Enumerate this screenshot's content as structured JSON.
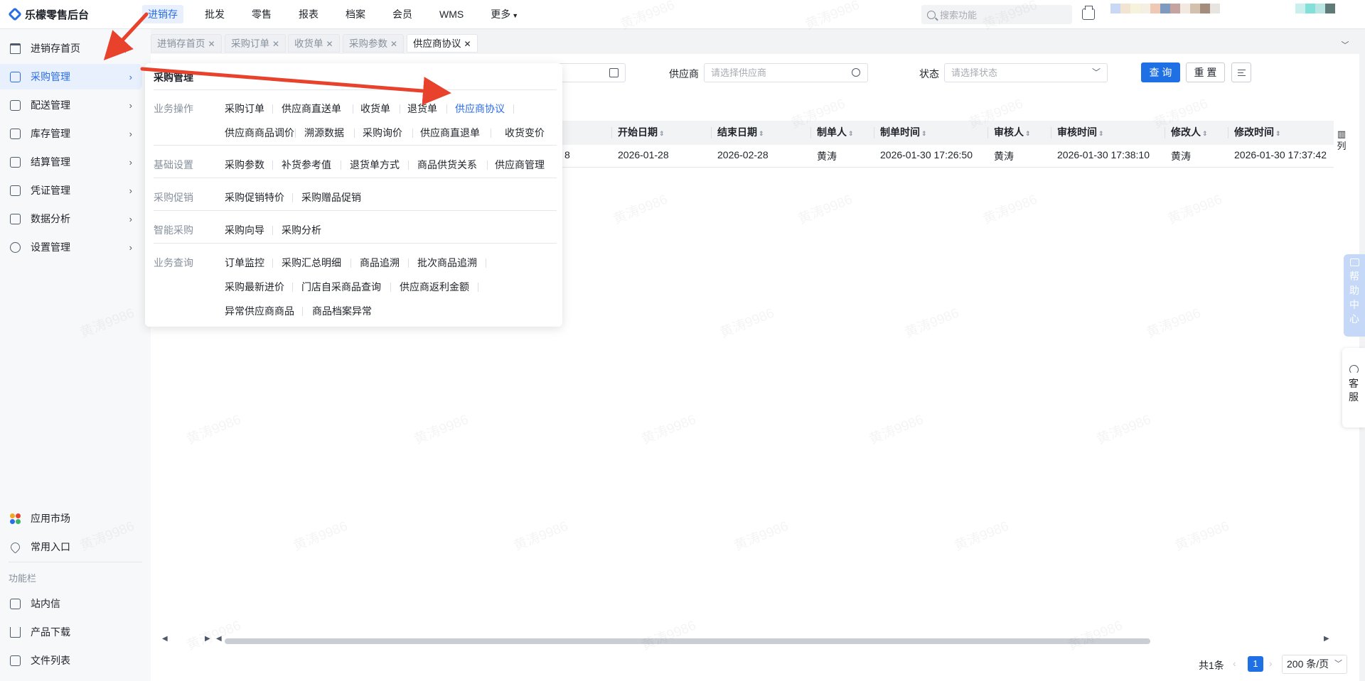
{
  "app": {
    "title": "乐檬零售后台"
  },
  "topnav": {
    "items": [
      "进销存",
      "批发",
      "零售",
      "报表",
      "档案",
      "会员",
      "WMS",
      "更多"
    ],
    "search_placeholder": "搜索功能"
  },
  "sidebar": {
    "items": [
      {
        "label": "进销存首页",
        "icon": "home-icon"
      },
      {
        "label": "采购管理",
        "icon": "cart-icon"
      },
      {
        "label": "配送管理",
        "icon": "delivery-icon"
      },
      {
        "label": "库存管理",
        "icon": "inventory-icon"
      },
      {
        "label": "结算管理",
        "icon": "settlement-icon"
      },
      {
        "label": "凭证管理",
        "icon": "voucher-icon"
      },
      {
        "label": "数据分析",
        "icon": "chart-icon"
      },
      {
        "label": "设置管理",
        "icon": "settings-icon"
      }
    ],
    "bottom": {
      "app_market": "应用市场",
      "favorites": "常用入口",
      "section_caption": "功能栏",
      "messages": "站内信",
      "downloads": "产品下载",
      "files": "文件列表"
    }
  },
  "tabs": [
    {
      "label": "进销存首页"
    },
    {
      "label": "采购订单"
    },
    {
      "label": "收货单"
    },
    {
      "label": "采购参数"
    },
    {
      "label": "供应商协议"
    }
  ],
  "filters": {
    "supplier_label": "供应商",
    "supplier_placeholder": "请选择供应商",
    "status_label": "状态",
    "status_placeholder": "请选择状态",
    "query_label": "查 询",
    "reset_label": "重 置"
  },
  "table": {
    "columns": [
      "开始日期",
      "结束日期",
      "制单人",
      "制单时间",
      "审核人",
      "审核时间",
      "修改人",
      "修改时间"
    ],
    "rows": [
      {
        "partial": "8",
        "start_date": "2026-01-28",
        "end_date": "2026-02-28",
        "creator": "黄涛",
        "created_at": "2026-01-30 17:26:50",
        "auditor": "黄涛",
        "audited_at": "2026-01-30 17:38:10",
        "modifier": "黄涛",
        "modified_at": "2026-01-30 17:37:42"
      }
    ],
    "column_settings": "列"
  },
  "pagination": {
    "total": "共1条",
    "current": "1",
    "page_size": "200 条/页"
  },
  "floating": {
    "help": [
      "帮",
      "助",
      "中",
      "心"
    ],
    "service": [
      "客",
      "服"
    ]
  },
  "mega_menu": {
    "title": "采购管理",
    "groups": [
      {
        "category": "业务操作",
        "rows": [
          [
            "采购订单",
            "供应商直送单",
            "收货单",
            "退货单",
            "供应商协议"
          ],
          [
            "供应商商品调价",
            "溯源数据",
            "采购询价",
            "供应商直退单",
            "收货变价"
          ]
        ]
      },
      {
        "category": "基础设置",
        "rows": [
          [
            "采购参数",
            "补货参考值",
            "退货单方式",
            "商品供货关系",
            "供应商管理"
          ]
        ]
      },
      {
        "category": "采购促销",
        "rows": [
          [
            "采购促销特价",
            "采购赠品促销"
          ]
        ]
      },
      {
        "category": "智能采购",
        "rows": [
          [
            "采购向导",
            "采购分析"
          ]
        ]
      },
      {
        "category": "业务查询",
        "rows": [
          [
            "订单监控",
            "采购汇总明细",
            "商品追溯",
            "批次商品追溯"
          ],
          [
            "采购最新进价",
            "门店自采商品查询",
            "供应商返利金额"
          ],
          [
            "异常供应商商品",
            "商品档案异常"
          ]
        ]
      }
    ],
    "active_item": "供应商协议"
  },
  "watermark": "黄涛9986",
  "colors": {
    "accent": "#2b6de5",
    "primary_button": "#1f6fe5",
    "annotation_arrow": "#e8412c"
  }
}
